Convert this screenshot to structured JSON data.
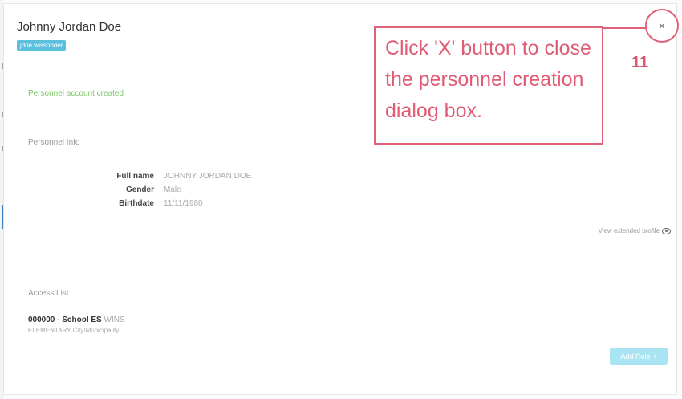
{
  "dialog": {
    "title": "Johnny Jordan Doe",
    "username_badge": "jdoe.wissonder",
    "success_message": "Personnel account created"
  },
  "personnel_info": {
    "heading": "Personnel Info",
    "rows": [
      {
        "label": "Full name",
        "value": "JOHNNY JORDAN DOE"
      },
      {
        "label": "Gender",
        "value": "Male"
      },
      {
        "label": "Birthdate",
        "value": "11/11/1980"
      }
    ],
    "extended_profile_link": "View extended profile",
    "extended_profile_icon": "eye-icon"
  },
  "access_list": {
    "heading": "Access List",
    "items": [
      {
        "code_name": "000000 - School ES",
        "rest": "WINS",
        "subtitle": "ELEMENTARY City/Municipality"
      }
    ],
    "add_role_label": "Add Role",
    "add_role_icon": "plus-icon"
  },
  "close_button": {
    "glyph": "×",
    "icon": "close-icon"
  },
  "annotation": {
    "callout_text": "Click 'X' button to close the personnel creation dialog box.",
    "step_number": "11",
    "color": "#e06178"
  }
}
